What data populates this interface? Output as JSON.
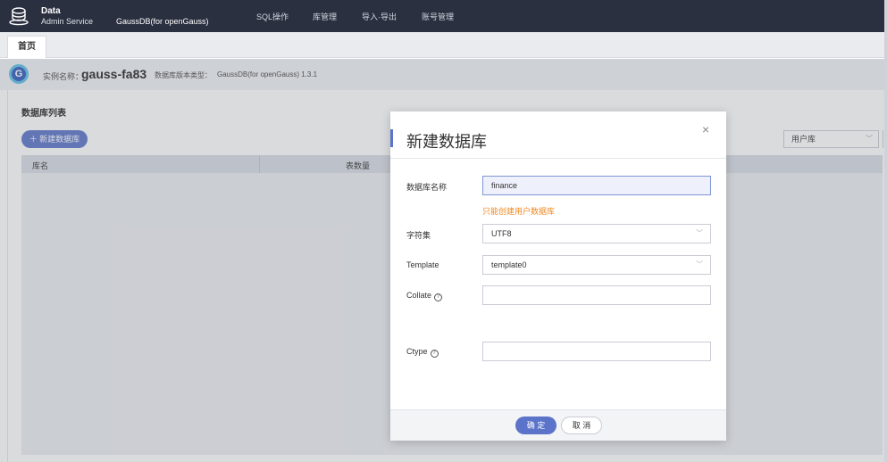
{
  "header": {
    "logo_line1": "Data",
    "logo_line2": "Admin Service",
    "product": "GaussDB(for openGauss)",
    "nav": [
      {
        "label": "SQL操作"
      },
      {
        "label": "库管理"
      },
      {
        "label": "导入·导出"
      },
      {
        "label": "账号管理"
      }
    ]
  },
  "tabs": {
    "home": "首页"
  },
  "instance": {
    "logo_letter": "G",
    "name_label": "实例名称：",
    "name": "gauss-fa83",
    "version_label": "数据库版本类型：",
    "version": "GaussDB(for openGauss) 1.3.1"
  },
  "main": {
    "section_title": "数据库列表",
    "new_db_button": "＋ 新建数据库",
    "filter": {
      "selected": "用户库"
    },
    "columns": {
      "name": "库名",
      "table_count": "表数量"
    }
  },
  "dialog": {
    "title": "新建数据库",
    "close": "×",
    "fields": {
      "name": {
        "label": "数据库名称",
        "value": "finance",
        "hint": "只能创建用户数据库"
      },
      "charset": {
        "label": "字符集",
        "value": "UTF8"
      },
      "template": {
        "label": "Template",
        "value": "template0"
      },
      "collate": {
        "label": "Collate",
        "value": ""
      },
      "ctype": {
        "label": "Ctype",
        "value": ""
      }
    },
    "help_glyph": "?",
    "ok": "确 定",
    "cancel": "取 消"
  },
  "colors": {
    "accent": "#5b73c9",
    "header_bg": "#2b3040",
    "hint": "#f08a24"
  }
}
